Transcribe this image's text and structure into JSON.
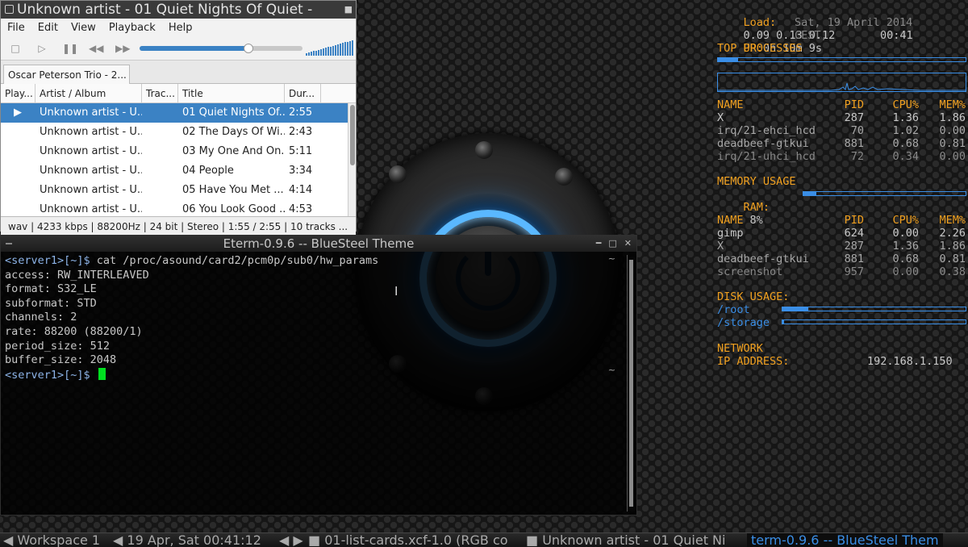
{
  "player": {
    "title": "Unknown artist - 01 Quiet Nights Of Quiet -",
    "menu": [
      "File",
      "Edit",
      "View",
      "Playback",
      "Help"
    ],
    "progress": 0.67,
    "volume": 1.0,
    "tab": "Oscar Peterson Trio - 2...",
    "columns": [
      "Play...",
      "Artist / Album",
      "Trac...",
      "Title",
      "Dur..."
    ],
    "rows": [
      {
        "artist": "Unknown artist - U...",
        "title": "01 Quiet Nights Of...",
        "duration": "2:55"
      },
      {
        "artist": "Unknown artist - U...",
        "title": "02 The Days Of Wi...",
        "duration": "2:43"
      },
      {
        "artist": "Unknown artist - U...",
        "title": "03 My One And On...",
        "duration": "5:11"
      },
      {
        "artist": "Unknown artist - U...",
        "title": "04 People",
        "duration": "3:34"
      },
      {
        "artist": "Unknown artist - U...",
        "title": "05 Have You Met ...",
        "duration": "4:14"
      },
      {
        "artist": "Unknown artist - U...",
        "title": "06 You Look Good ...",
        "duration": "4:53"
      }
    ],
    "status": "wav | 4233 kbps | 88200Hz | 24 bit | Stereo | 1:55 / 2:55 | 10 tracks ..."
  },
  "terminal": {
    "title": "Eterm-0.9.6 -- BlueSteel Theme",
    "prompt": "<server1>[~]$",
    "command": " cat /proc/asound/card2/pcm0p/sub0/hw_params",
    "output": [
      "access: RW_INTERLEAVED",
      "format: S32_LE",
      "subformat: STD",
      "channels: 2",
      "rate: 88200 (88200/1)",
      "period_size: 512",
      "buffer_size: 2048"
    ]
  },
  "conky": {
    "load_label": "Load:",
    "load_values": "0.09 0.13 0.12",
    "uptime_label": "UP:",
    "uptime": "0h 10m 9s",
    "date": "Sat, 19 April 2014",
    "tz": "CEST,",
    "time": "00:41",
    "top_title": "TOP PROCESSES",
    "top_bar": 0.08,
    "proc_headers": [
      "NAME",
      "PID",
      "CPU%",
      "MEM%"
    ],
    "top_processes": [
      {
        "name": "X",
        "pid": "287",
        "cpu": "1.36",
        "mem": "1.86"
      },
      {
        "name": "irq/21-ehci_hcd",
        "pid": "70",
        "cpu": "1.02",
        "mem": "0.00"
      },
      {
        "name": "deadbeef-gtkui",
        "pid": "881",
        "cpu": "0.68",
        "mem": "0.81"
      },
      {
        "name": "irq/21-uhci_hcd",
        "pid": "72",
        "cpu": "0.34",
        "mem": "0.00"
      }
    ],
    "mem_title": "MEMORY USAGE",
    "ram_label": "RAM:",
    "ram_value": "8%",
    "ram_fraction": 0.08,
    "mem_processes": [
      {
        "name": "gimp",
        "pid": "624",
        "cpu": "0.00",
        "mem": "2.26"
      },
      {
        "name": "X",
        "pid": "287",
        "cpu": "1.36",
        "mem": "1.86"
      },
      {
        "name": "deadbeef-gtkui",
        "pid": "881",
        "cpu": "0.68",
        "mem": "0.81"
      },
      {
        "name": "screenshot",
        "pid": "957",
        "cpu": "0.00",
        "mem": "0.38"
      }
    ],
    "disk_title": "DISK USAGE:",
    "disks": [
      {
        "name": "/root",
        "fraction": 0.14
      },
      {
        "name": "/storage",
        "fraction": 0.01
      }
    ],
    "net_title": "NETWORK",
    "ip_label": "IP ADDRESS:",
    "ip": "192.168.1.150"
  },
  "panel": {
    "workspace": "Workspace 1",
    "clock": "19 Apr, Sat 00:41:12",
    "task1": "01-list-cards.xcf-1.0 (RGB co",
    "task2": "Unknown artist - 01 Quiet Ni",
    "task3": "term-0.9.6 -- BlueSteel Them"
  },
  "colors": {
    "accent_blue": "#3a8ee6",
    "conky_orange": "#f0a020",
    "cursor_green": "#00e020",
    "selection_blue": "#3b82c4"
  }
}
